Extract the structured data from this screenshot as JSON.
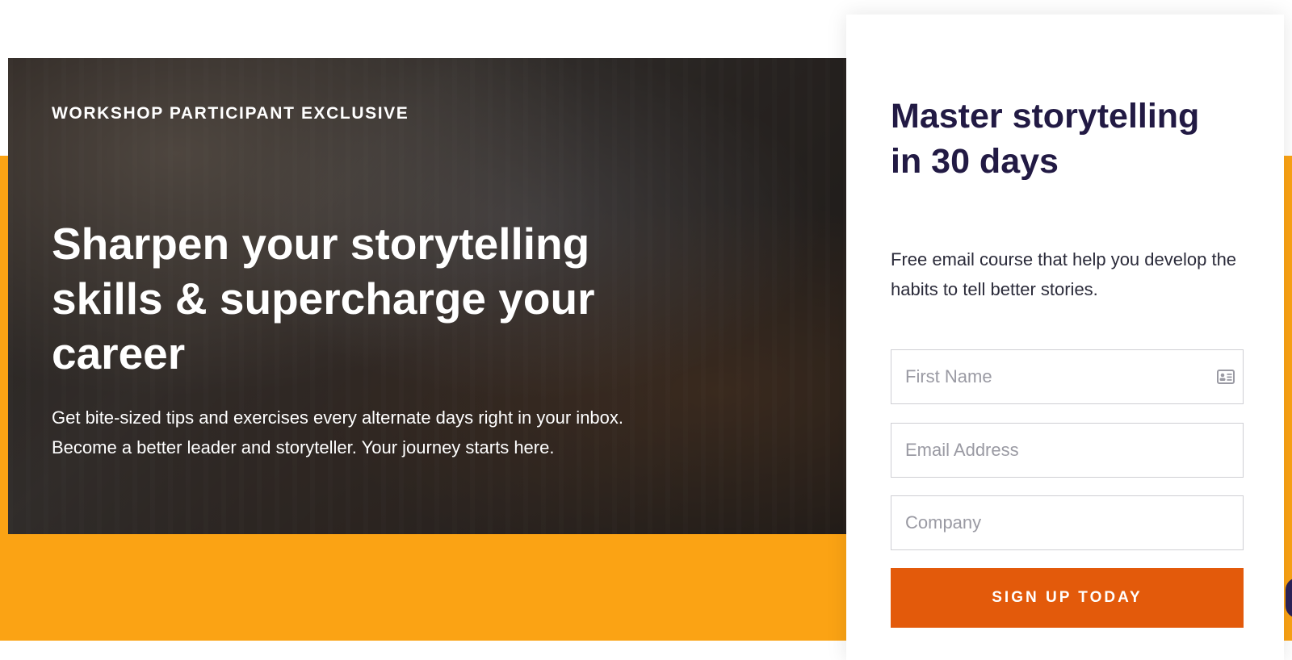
{
  "hero": {
    "eyebrow": "WORKSHOP PARTICIPANT EXCLUSIVE",
    "headline": "Sharpen your storytelling skills & supercharge your career",
    "subtext_line1": "Get bite-sized tips and exercises every alternate days right in your inbox.",
    "subtext_line2": "Become a better leader and storyteller. Your journey starts here."
  },
  "signup": {
    "title": "Master storytelling in 30 days",
    "description": "Free email course that help you develop the habits to tell better stories.",
    "fields": {
      "first_name_placeholder": "First Name",
      "email_placeholder": "Email Address",
      "company_placeholder": "Company"
    },
    "first_name_icon": "contact-card-icon",
    "submit_label": "SIGN UP TODAY"
  },
  "colors": {
    "accent_orange": "#fba314",
    "button_orange": "#e35a0b",
    "title_navy": "#221a44"
  }
}
